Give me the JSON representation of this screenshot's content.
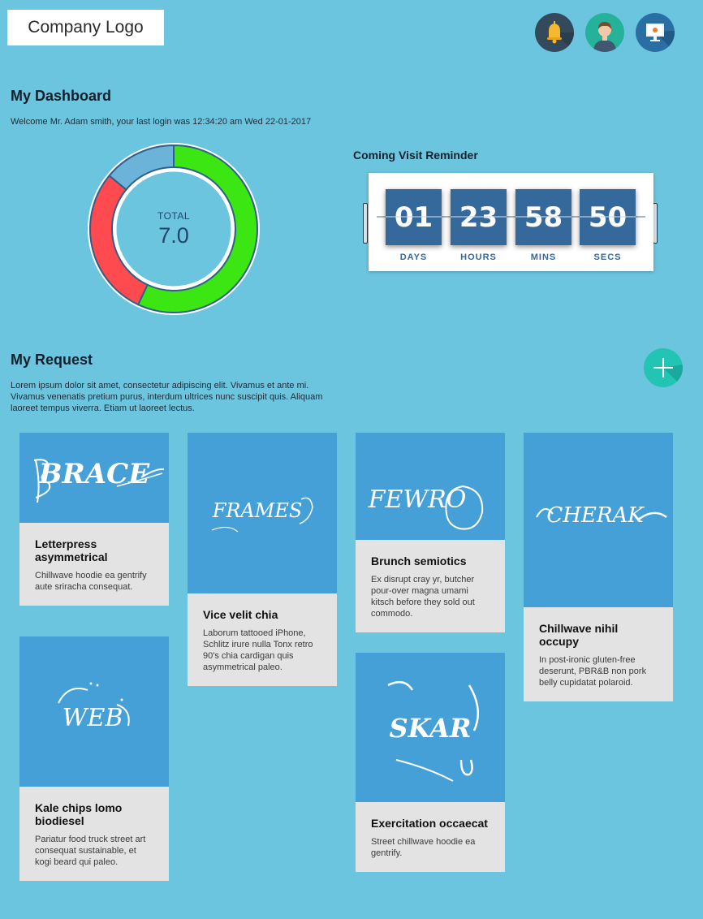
{
  "header": {
    "logo_text": "Company Logo",
    "icons": [
      "bell-icon",
      "user-avatar-icon",
      "presentation-monitor-icon"
    ]
  },
  "dashboard": {
    "title": "My Dashboard",
    "welcome": "Welcome Mr. Adam smith, your last login was 12:34:20 am Wed 22-01-2017",
    "donut": {
      "label": "TOTAL",
      "value": "7.0",
      "segments": [
        {
          "color": "#3be613",
          "fraction": 0.57
        },
        {
          "color": "#ff4a4f",
          "fraction": 0.29
        },
        {
          "color": "#6bb3d8",
          "fraction": 0.14
        }
      ]
    }
  },
  "reminder": {
    "title": "Coming Visit Reminder",
    "units": [
      {
        "value": "01",
        "label": "DAYS"
      },
      {
        "value": "23",
        "label": "HOURS"
      },
      {
        "value": "58",
        "label": "MINS"
      },
      {
        "value": "50",
        "label": "SECS"
      }
    ]
  },
  "requests": {
    "title": "My Request",
    "description": "Lorem ipsum dolor sit amet, consectetur adipiscing elit. Vivamus et ante mi. Vivamus venenatis pretium purus, interdum ultrices nunc suscipit quis. Aliquam laoreet tempus viverra. Etiam ut laoreet lectus.",
    "add_icon": "plus-icon",
    "cards": [
      {
        "image_text": "BRACE",
        "title": "Letterpress asymmetrical",
        "text": "Chillwave hoodie ea gentrify aute sriracha consequat."
      },
      {
        "image_text": "FRAMES",
        "title": "Vice velit chia",
        "text": "Laborum tattooed iPhone, Schlitz irure nulla Tonx retro 90's chia cardigan quis asymmetrical paleo."
      },
      {
        "image_text": "FEWRO",
        "title": "Brunch semiotics",
        "text": "Ex disrupt cray yr, butcher pour-over magna umami kitsch before they sold out commodo."
      },
      {
        "image_text": "CHERAK",
        "title": "Chillwave nihil occupy",
        "text": "In post-ironic gluten-free deserunt, PBR&B non pork belly cupidatat polaroid."
      },
      {
        "image_text": "WEB",
        "title": "Kale chips lomo biodiesel",
        "text": "Pariatur food truck street art consequat sustainable, et kogi beard qui paleo."
      },
      {
        "image_text": "SKAR",
        "title": "Exercitation occaecat",
        "text": "Street chillwave hoodie ea gentrify."
      }
    ]
  }
}
